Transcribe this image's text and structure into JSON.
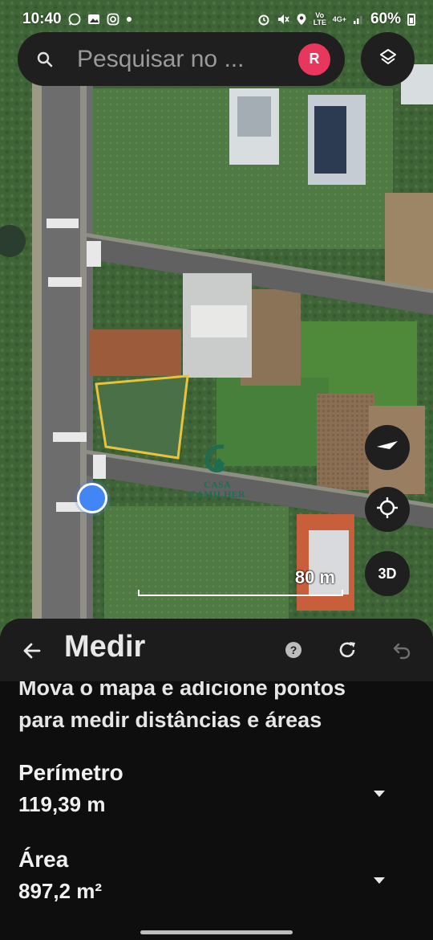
{
  "status_bar": {
    "time": "10:40",
    "network_type": "4G+",
    "volte": "Vo LTE",
    "battery": "60%",
    "icons": [
      "whatsapp-icon",
      "gallery-icon",
      "instagram-icon",
      "dot-icon",
      "alarm-icon",
      "mute-icon",
      "location-icon",
      "signal-icon",
      "battery-icon"
    ]
  },
  "search": {
    "placeholder": "Pesquisar no ...",
    "avatar_initial": "R",
    "avatar_color": "#e8365d"
  },
  "map": {
    "scale_label": "80 m",
    "button_3d": "3D",
    "watermark_line1": "CASA",
    "watermark_line2": "CAMILHER",
    "measure_outline_color": "#e8c33c",
    "location_dot_color": "#4285f4"
  },
  "sheet": {
    "title": "Medir",
    "instruction_line1": "Mova o mapa e adicione pontos",
    "instruction_line2": "para medir distâncias e áreas",
    "perimeter_label": "Perímetro",
    "perimeter_value": "119,39 m",
    "area_label": "Área",
    "area_value": "897,2 m²"
  }
}
